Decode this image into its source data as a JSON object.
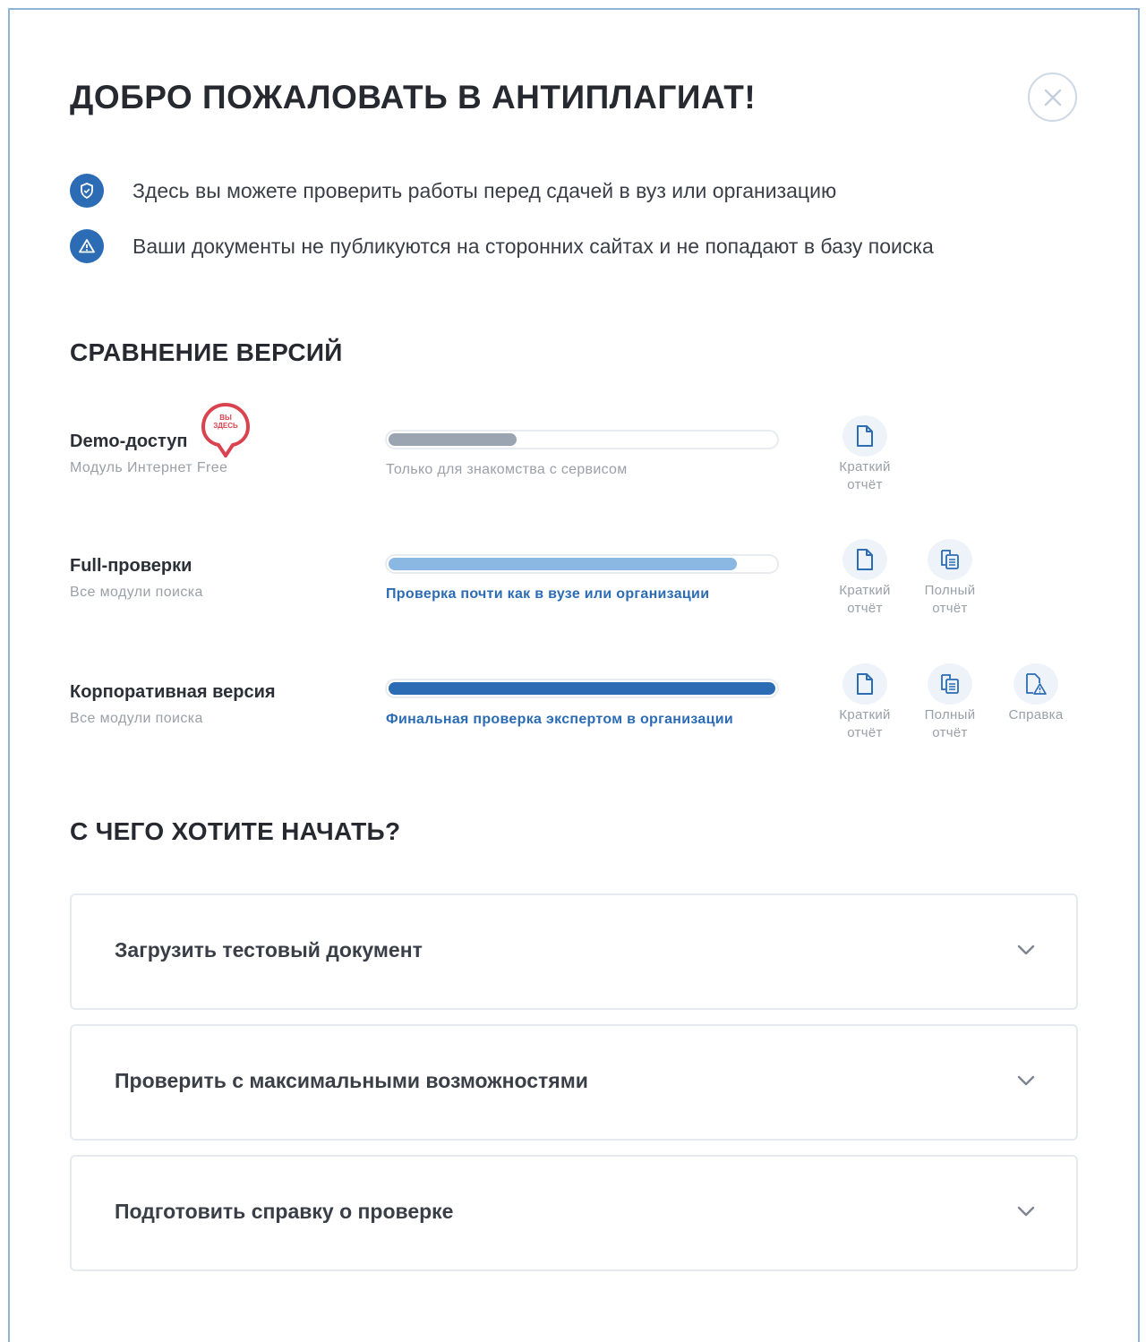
{
  "header": {
    "title": "ДОБРО ПОЖАЛОВАТЬ В АНТИПЛАГИАТ!"
  },
  "info": [
    {
      "icon": "shield-icon",
      "text": "Здесь вы можете проверить работы перед сдачей в вуз или организацию"
    },
    {
      "icon": "warning-icon",
      "text": "Ваши документы не публикуются на сторонних сайтах и не попадают в базу поиска"
    }
  ],
  "compare": {
    "title": "СРАВНЕНИЕ ВЕРСИЙ",
    "badge": "ВЫ ЗДЕСЬ",
    "versions": [
      {
        "name": "Demo-доступ",
        "sub": "Модуль Интернет Free",
        "level": 0.33,
        "color": "#9aa5b1",
        "caption": "Только для знакомства с сервисом",
        "caption_color": "#9aa0a8",
        "reports": [
          {
            "icon": "document-icon",
            "l1": "Краткий",
            "l2": "отчёт"
          }
        ]
      },
      {
        "name": "Full-проверки",
        "sub": "Все модули поиска",
        "level": 0.9,
        "color": "#8ab8e2",
        "caption": "Проверка почти как в вузе или организации",
        "caption_color": "#2b6cb4",
        "reports": [
          {
            "icon": "document-icon",
            "l1": "Краткий",
            "l2": "отчёт"
          },
          {
            "icon": "full-report-icon",
            "l1": "Полный",
            "l2": "отчёт"
          }
        ]
      },
      {
        "name": "Корпоративная версия",
        "sub": "Все модули поиска",
        "level": 1.0,
        "color": "#2b6cb4",
        "caption": "Финальная проверка экспертом в организации",
        "caption_color": "#2b6cb4",
        "reports": [
          {
            "icon": "document-icon",
            "l1": "Краткий",
            "l2": "отчёт"
          },
          {
            "icon": "full-report-icon",
            "l1": "Полный",
            "l2": "отчёт"
          },
          {
            "icon": "certificate-icon",
            "l1": "Справка",
            "l2": ""
          }
        ]
      }
    ]
  },
  "start": {
    "title": "С ЧЕГО ХОТИТЕ НАЧАТЬ?",
    "items": [
      "Загрузить тестовый документ",
      "Проверить с максимальными возможностями",
      "Подготовить справку о проверке"
    ]
  }
}
